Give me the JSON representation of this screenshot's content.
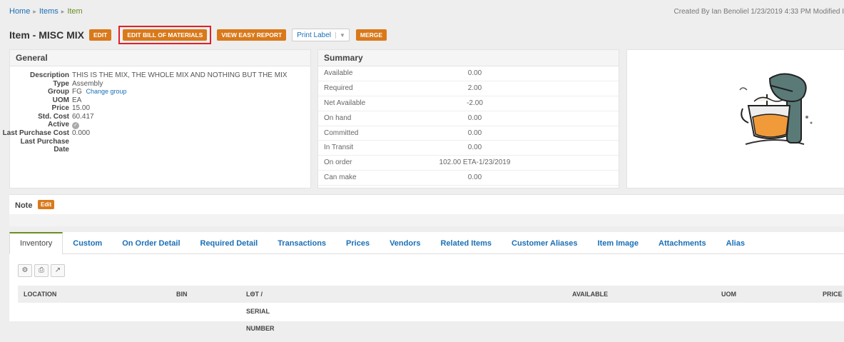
{
  "breadcrumb": {
    "home": "Home",
    "items": "Items",
    "current": "Item"
  },
  "created_text": "Created By Ian Benoliel 1/23/2019 4:33 PM  Modified I",
  "title": "Item - MISC MIX",
  "buttons": {
    "edit": "EDIT",
    "edit_bom": "EDIT BILL OF MATERIALS",
    "view_easy_report": "VIEW EASY REPORT",
    "print_label": "Print Label",
    "merge": "MERGE"
  },
  "general": {
    "header": "General",
    "fields": {
      "description_label": "Description",
      "description": "THIS IS THE MIX, THE WHOLE MIX AND NOTHING BUT THE MIX",
      "type_label": "Type",
      "type": "Assembly",
      "group_label": "Group",
      "group": "FG",
      "change_group": "Change group",
      "uom_label": "UOM",
      "uom": "EA",
      "price_label": "Price",
      "price": "15.00",
      "std_cost_label": "Std. Cost",
      "std_cost": "60.417",
      "active_label": "Active",
      "last_purchase_cost_label": "Last Purchase Cost",
      "last_purchase_cost": "0.000",
      "last_purchase_date_label_1": "Last Purchase",
      "last_purchase_date_label_2": "Date"
    }
  },
  "summary": {
    "header": "Summary",
    "rows": [
      {
        "label": "Available",
        "value": "0.00"
      },
      {
        "label": "Required",
        "value": "2.00"
      },
      {
        "label": "Net Available",
        "value": "-2.00"
      },
      {
        "label": "On hand",
        "value": "0.00"
      },
      {
        "label": "Committed",
        "value": "0.00"
      },
      {
        "label": "In Transit",
        "value": "0.00"
      },
      {
        "label": "On order",
        "value": "102.00 ETA-1/23/2019"
      },
      {
        "label": "Can make",
        "value": "0.00"
      }
    ]
  },
  "note": {
    "label": "Note",
    "edit": "Edit"
  },
  "tabs": [
    "Inventory",
    "Custom",
    "On Order Detail",
    "Required Detail",
    "Transactions",
    "Prices",
    "Vendors",
    "Related Items",
    "Customer Aliases",
    "Item Image",
    "Attachments",
    "Alias"
  ],
  "table": {
    "headers": {
      "location": "LOCATION",
      "bin": "BIN",
      "lot": "LOT / SERIAL NUMBER",
      "available": "AVAILABLE",
      "uom": "UOM",
      "price": "PRICE"
    }
  },
  "colors": {
    "accent": "#d9791a",
    "link": "#1a6fb5",
    "highlight": "#e0202a"
  }
}
